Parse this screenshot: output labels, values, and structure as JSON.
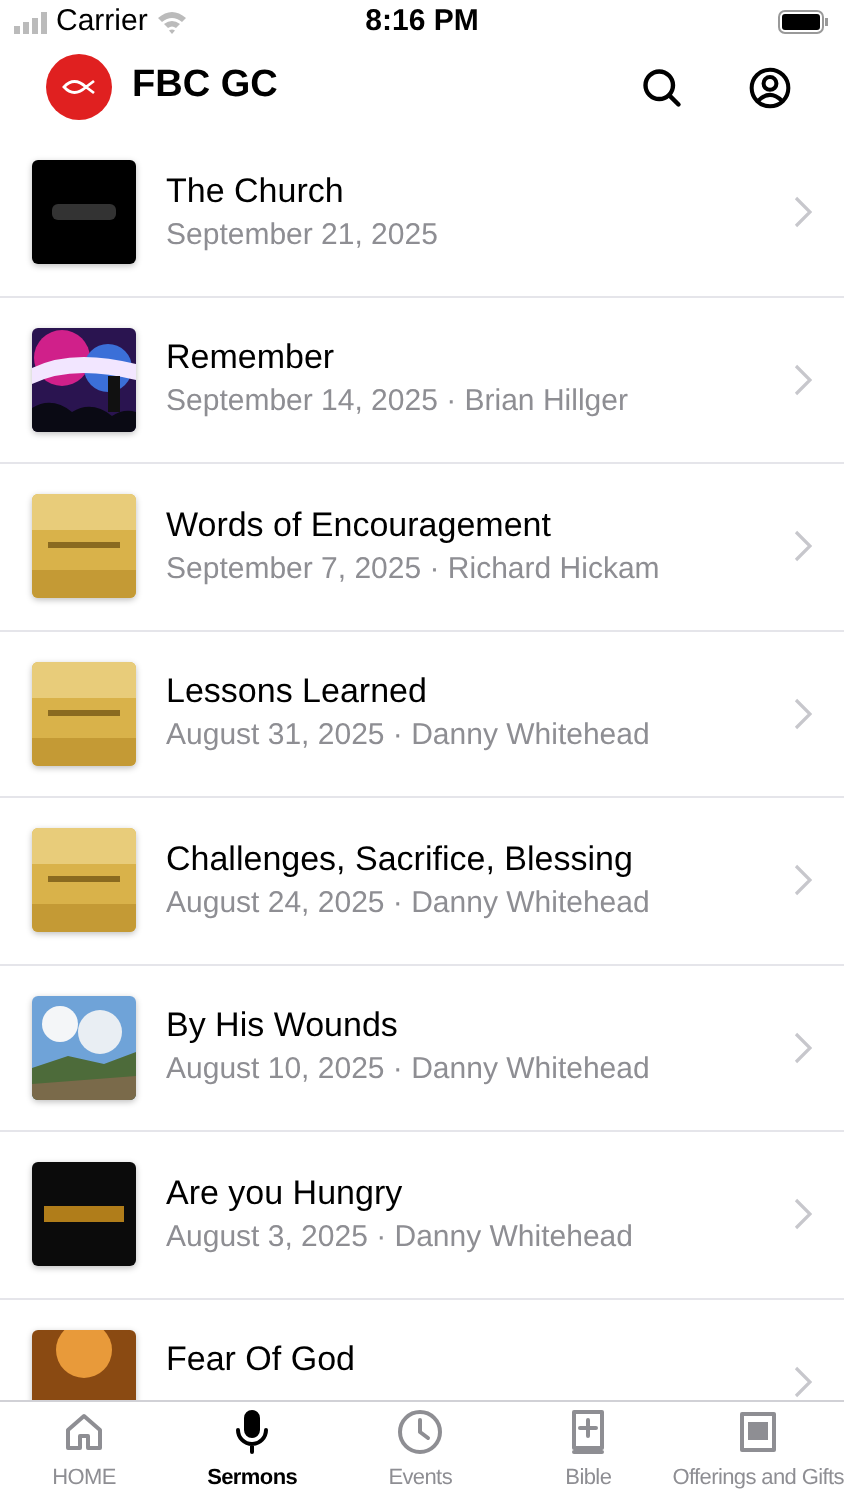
{
  "status_bar": {
    "carrier": "Carrier",
    "time": "8:16 PM"
  },
  "header": {
    "title": "FBC GC"
  },
  "sermons": [
    {
      "title": "The Church",
      "subtitle": "September 21, 2025"
    },
    {
      "title": "Remember",
      "subtitle": "September 14, 2025 · Brian Hillger"
    },
    {
      "title": "Words of Encouragement",
      "subtitle": "September 7, 2025 · Richard Hickam"
    },
    {
      "title": "Lessons Learned",
      "subtitle": "August 31, 2025 · Danny Whitehead"
    },
    {
      "title": "Challenges, Sacrifice, Blessing",
      "subtitle": "August 24, 2025 · Danny Whitehead"
    },
    {
      "title": "By His Wounds",
      "subtitle": "August 10, 2025 · Danny Whitehead"
    },
    {
      "title": "Are you Hungry",
      "subtitle": "August 3, 2025 · Danny Whitehead"
    },
    {
      "title": "Fear Of God"
    }
  ],
  "tab_bar": [
    {
      "label": "HOME",
      "kind": "home",
      "selected": false
    },
    {
      "label": "Sermons",
      "kind": "mic",
      "selected": true
    },
    {
      "label": "Events",
      "kind": "clock",
      "selected": false
    },
    {
      "label": "Bible",
      "kind": "bible",
      "selected": false
    },
    {
      "label": "Offerings and Gifts",
      "kind": "gifts",
      "selected": false
    }
  ]
}
